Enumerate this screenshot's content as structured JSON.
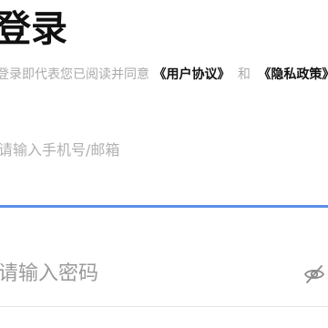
{
  "login": {
    "title": "登录",
    "agreement": {
      "prefix": "登录即代表您已阅读并同意",
      "user_agreement": "《用户协议》",
      "conjunction": "和",
      "privacy_policy": "《隐私政策》"
    },
    "phone_field": {
      "placeholder": "请输入手机号/邮箱",
      "value": ""
    },
    "password_field": {
      "placeholder": "请输入密码",
      "value": ""
    },
    "password_toggle_icon": "eye-off-icon"
  },
  "colors": {
    "accent": "#5b8fe8",
    "title": "#111111",
    "muted": "#aaaaaa",
    "placeholder": "#b0b0b0"
  }
}
